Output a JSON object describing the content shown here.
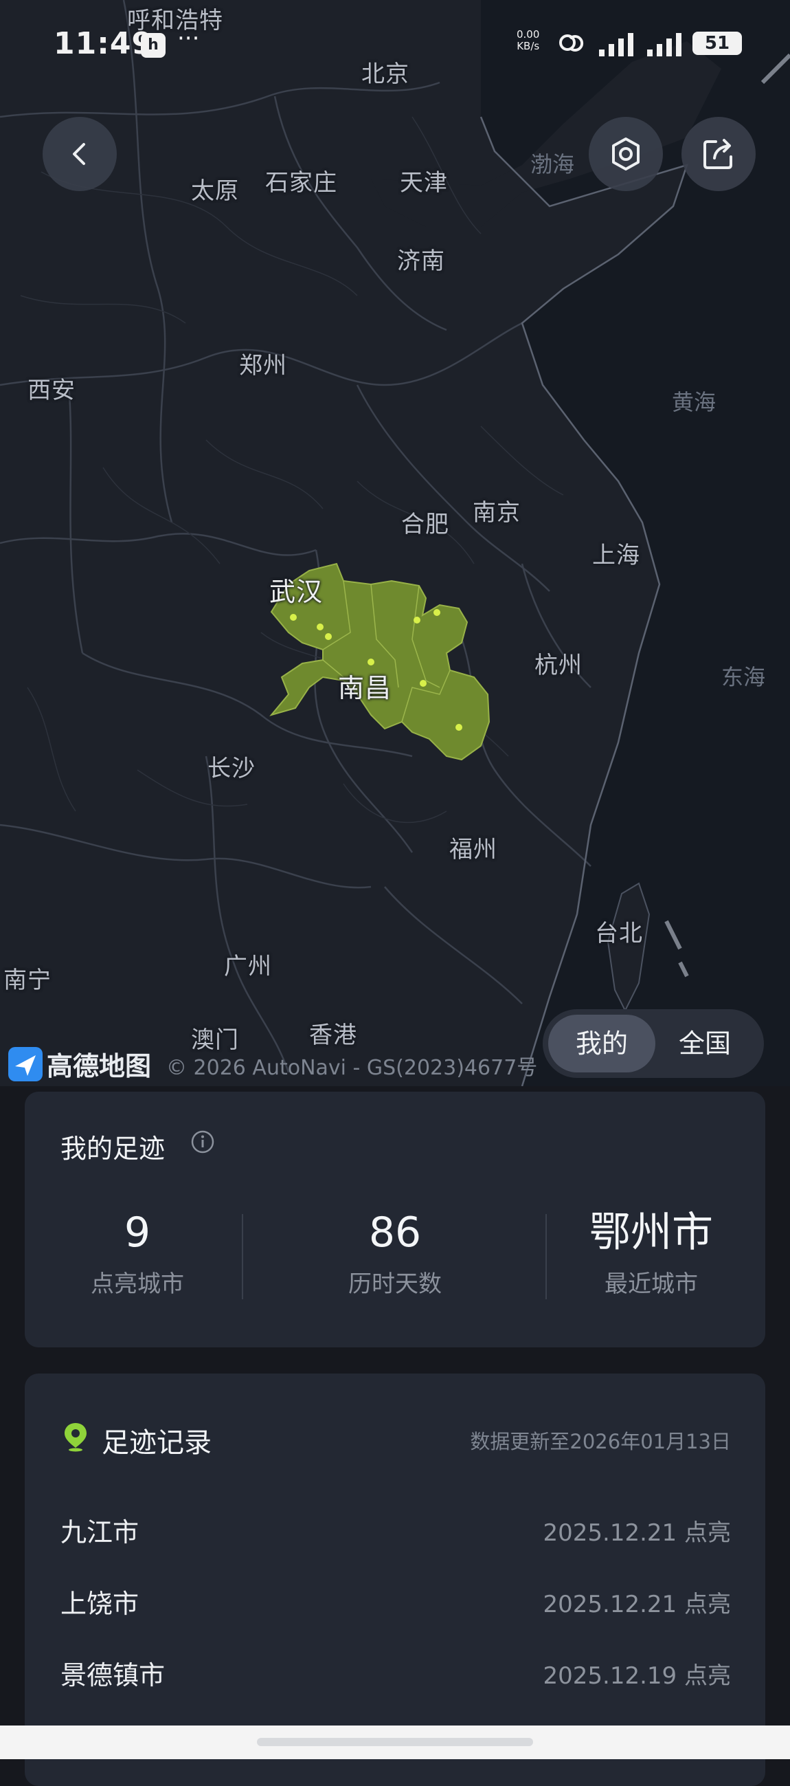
{
  "status_bar": {
    "time": "11:49",
    "net_speed_value": "0.00",
    "net_speed_unit": "KB/s",
    "battery": "51"
  },
  "map": {
    "cities": [
      {
        "name": "呼和浩特",
        "style": "normal"
      },
      {
        "name": "北京",
        "style": "normal"
      },
      {
        "name": "太原",
        "style": "normal"
      },
      {
        "name": "石家庄",
        "style": "normal"
      },
      {
        "name": "天津",
        "style": "normal"
      },
      {
        "name": "济南",
        "style": "normal"
      },
      {
        "name": "郑州",
        "style": "normal"
      },
      {
        "name": "西安",
        "style": "normal"
      },
      {
        "name": "合肥",
        "style": "normal"
      },
      {
        "name": "南京",
        "style": "normal"
      },
      {
        "name": "上海",
        "style": "normal"
      },
      {
        "name": "武汉",
        "style": "big"
      },
      {
        "name": "南昌",
        "style": "big"
      },
      {
        "name": "杭州",
        "style": "normal"
      },
      {
        "name": "长沙",
        "style": "normal"
      },
      {
        "name": "福州",
        "style": "normal"
      },
      {
        "name": "台北",
        "style": "normal"
      },
      {
        "name": "广州",
        "style": "normal"
      },
      {
        "name": "南宁",
        "style": "normal"
      },
      {
        "name": "澳门",
        "style": "normal"
      },
      {
        "name": "香港",
        "style": "normal"
      }
    ],
    "seas": [
      "渤海",
      "黄海",
      "东海"
    ],
    "provider": "高德地图",
    "copyright": "© 2026 AutoNavi - GS(2023)4677号",
    "highlight_color": "#6f8a2e",
    "dot_color": "#d8f04a",
    "toggle": {
      "options": [
        "我的",
        "全国"
      ],
      "selected": "我的"
    }
  },
  "footprint": {
    "title": "我的足迹",
    "stats": [
      {
        "value": "9",
        "label": "点亮城市"
      },
      {
        "value": "86",
        "label": "历时天数"
      },
      {
        "value": "鄂州市",
        "label": "最近城市"
      }
    ]
  },
  "records": {
    "title": "足迹记录",
    "updated": "数据更新至2026年01月13日",
    "icon_color": "#8fd33a",
    "items": [
      {
        "city": "九江市",
        "date": "2025.12.21 点亮"
      },
      {
        "city": "上饶市",
        "date": "2025.12.21 点亮"
      },
      {
        "city": "景德镇市",
        "date": "2025.12.19 点亮"
      }
    ]
  }
}
